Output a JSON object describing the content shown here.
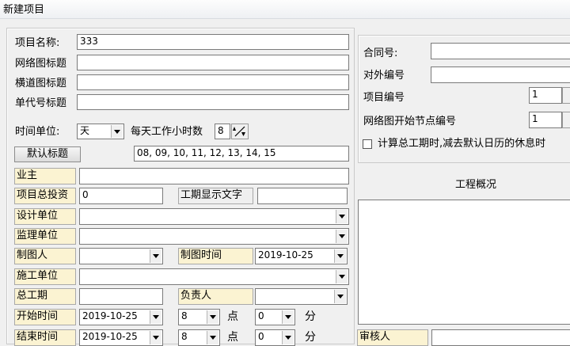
{
  "window": {
    "title": "新建项目"
  },
  "left": {
    "project_name_label": "项目名称:",
    "project_name_value": "333",
    "network_title_label": "网络图标题",
    "bar_title_label": "横道图标题",
    "code_title_label": "单代号标题",
    "time_unit_label": "时间单位:",
    "time_unit_value": "天",
    "daily_hours_label": "每天工作小时数",
    "daily_hours_value": "8",
    "default_title_button": "默认标题",
    "default_title_value": "08, 09, 10, 11, 12, 13, 14, 15",
    "owner_label": "业主",
    "total_investment_label": "项目总投资",
    "total_investment_value": "0",
    "duration_text_label": "工期显示文字",
    "design_unit_label": "设计单位",
    "supervision_unit_label": "监理单位",
    "drafter_label": "制图人",
    "draw_time_label": "制图时间",
    "draw_time_value": "2019-10-25",
    "construction_unit_label": "施工单位",
    "total_duration_label": "总工期",
    "responsible_label": "负责人",
    "start_time_label": "开始时间",
    "start_date_value": "2019-10-25",
    "start_hour_value": "8",
    "hour_unit": "点",
    "start_minute_value": "0",
    "minute_unit": "分",
    "end_time_label": "结束时间",
    "end_date_value": "2019-10-25",
    "end_hour_value": "8",
    "end_minute_value": "0"
  },
  "right": {
    "contract_no_label": "合同号:",
    "external_no_label": "对外编号",
    "project_no_label": "项目编号",
    "project_no_value": "1",
    "network_start_label": "网络图开始节点编号",
    "network_start_value": "1",
    "calc_checkbox_label": "计算总工期时,减去默认日历的休息时",
    "overview_label": "工程概况",
    "reviewer_label": "审核人"
  }
}
